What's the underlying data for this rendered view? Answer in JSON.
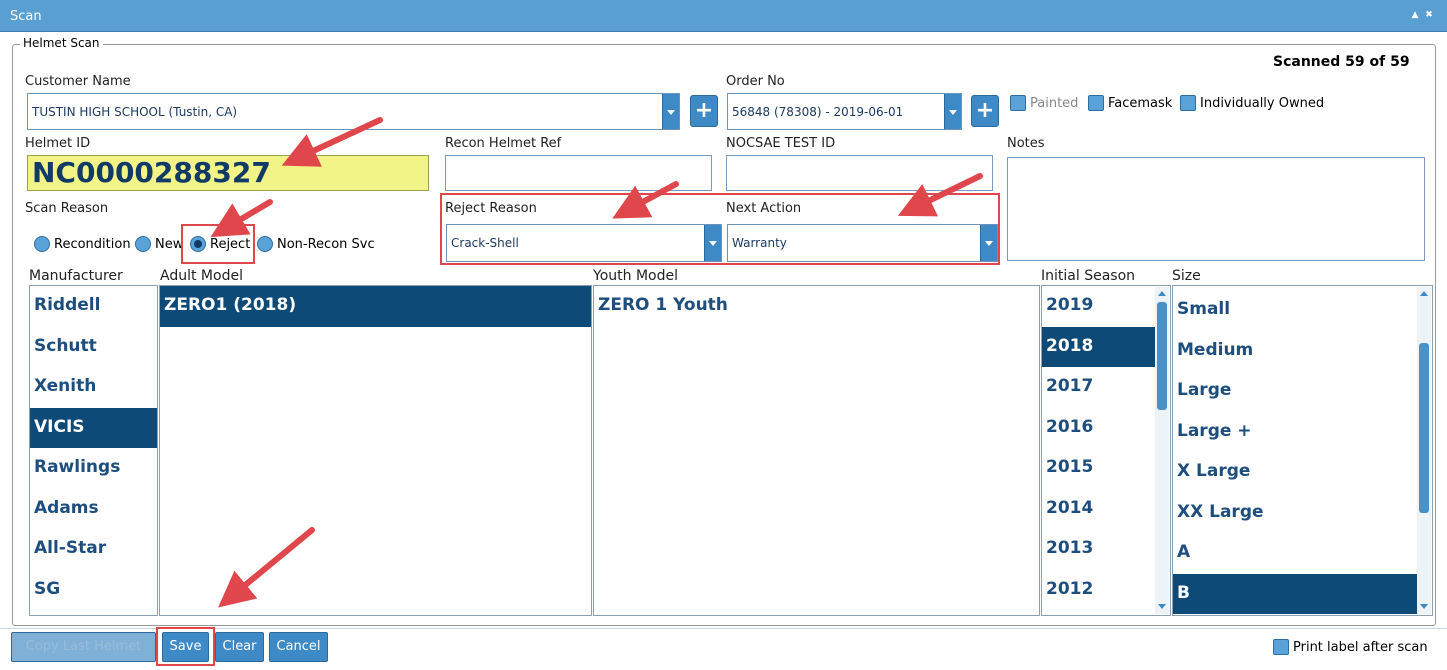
{
  "window": {
    "title": "Scan",
    "scanned": "Scanned 59 of 59"
  },
  "legend": "Helmet Scan",
  "customer": {
    "label": "Customer Name",
    "value": "TUSTIN HIGH SCHOOL (Tustin, CA)"
  },
  "order": {
    "label": "Order No",
    "value": "56848 (78308) - 2019-06-01"
  },
  "plus_label": "+",
  "checks": {
    "painted": "Painted",
    "facemask": "Facemask",
    "individually_owned": "Individually Owned"
  },
  "helmet": {
    "label": "Helmet ID",
    "value": "NC0000288327"
  },
  "recon_ref": {
    "label": "Recon Helmet Ref",
    "value": ""
  },
  "nocsae": {
    "label": "NOCSAE TEST ID",
    "value": ""
  },
  "notes": {
    "label": "Notes",
    "value": ""
  },
  "scan_reason": {
    "label": "Scan Reason",
    "options": [
      "Recondition",
      "New",
      "Reject",
      "Non-Recon Svc"
    ],
    "selected": "Reject"
  },
  "reject_reason": {
    "label": "Reject Reason",
    "value": "Crack-Shell"
  },
  "next_action": {
    "label": "Next Action",
    "value": "Warranty"
  },
  "columns": {
    "manufacturer": "Manufacturer",
    "adult_model": "Adult Model",
    "youth_model": "Youth Model",
    "initial_season": "Initial Season",
    "size": "Size"
  },
  "manufacturers": [
    "Riddell",
    "Schutt",
    "Xenith",
    "VICIS",
    "Rawlings",
    "Adams",
    "All-Star",
    "SG"
  ],
  "manufacturer_selected": "VICIS",
  "adult_models": [
    "ZERO1 (2018)"
  ],
  "adult_selected": "ZERO1 (2018)",
  "youth_models": [
    "ZERO 1 Youth"
  ],
  "seasons": [
    "2019",
    "2018",
    "2017",
    "2016",
    "2015",
    "2014",
    "2013",
    "2012"
  ],
  "season_selected": "2018",
  "sizes": [
    "Small",
    "Medium",
    "Large",
    "Large +",
    "X Large",
    "XX Large",
    "A",
    "B"
  ],
  "size_selected": "B",
  "buttons": {
    "copy_last": "Copy Last Helmet",
    "save": "Save",
    "clear": "Clear",
    "cancel": "Cancel"
  },
  "print_label": "Print label after scan",
  "colors": {
    "accent": "#3d8ac6",
    "selected": "#0e4a77",
    "highlight": "#f3f487",
    "annotation": "#e0474c"
  }
}
